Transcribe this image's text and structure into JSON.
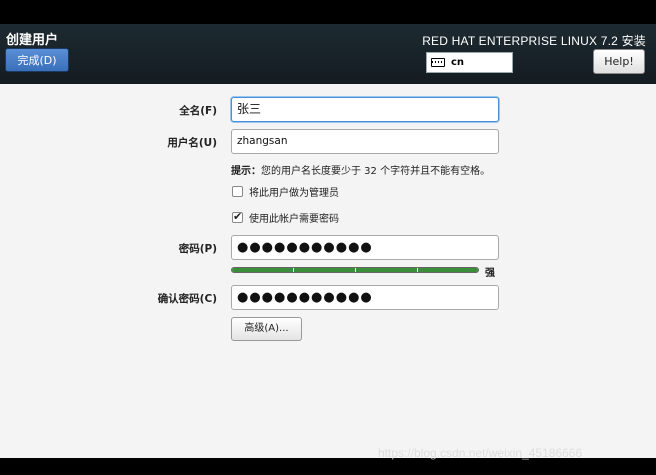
{
  "header": {
    "page_title": "创建用户",
    "done_label": "完成(D)",
    "product_title": "RED HAT ENTERPRISE LINUX 7.2 安装",
    "keyboard_layout": "cn",
    "help_label": "Help!"
  },
  "form": {
    "fullname_label": "全名(F)",
    "fullname_value": "张三",
    "username_label": "用户名(U)",
    "username_value": "zhangsan",
    "hint_prefix": "提示：",
    "hint_text": "您的用户名长度要少于 32 个字符并且不能有空格。",
    "admin_checkbox_label": "将此用户做为管理员",
    "admin_checked": false,
    "require_password_label": "使用此帐户需要密码",
    "require_password_checked": true,
    "password_label": "密码(P)",
    "password_value": "●●●●●●●●●●●",
    "strength_fraction": 1.0,
    "strength_label": "强",
    "confirm_label": "确认密码(C)",
    "confirm_value": "●●●●●●●●●●●",
    "advanced_label": "高级(A)..."
  },
  "watermark": "https://blog.csdn.net/weixin_45186666"
}
